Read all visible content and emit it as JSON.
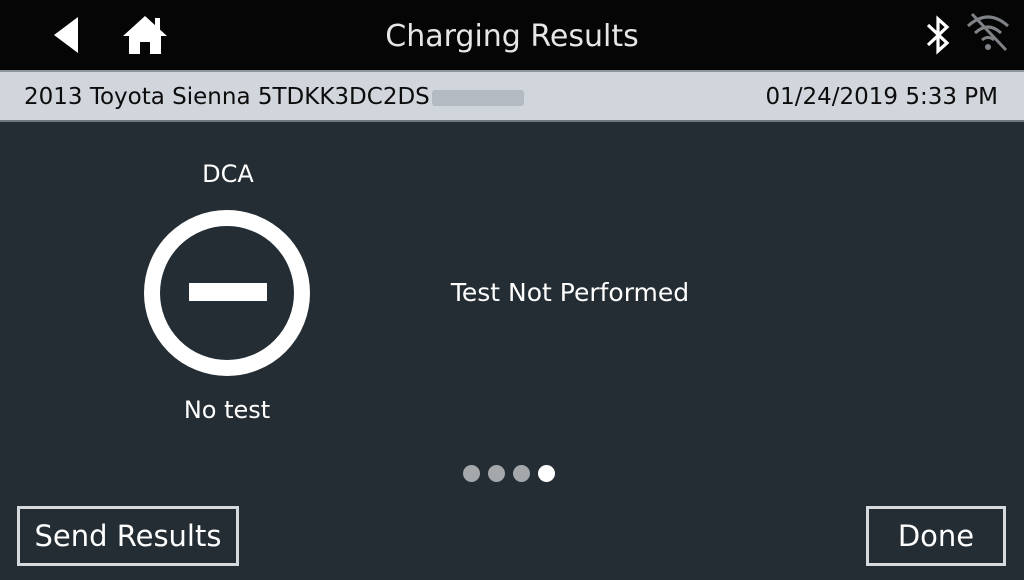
{
  "header": {
    "title": "Charging Results",
    "back_icon": "back-arrow-icon",
    "home_icon": "home-icon",
    "bluetooth_icon": "bluetooth-icon",
    "wifi_icon": "wifi-disconnected-icon"
  },
  "info_bar": {
    "vehicle": "2013 Toyota Sienna  5TDKK3DC2DS",
    "datetime": "01/24/2019 5:33 PM"
  },
  "result": {
    "test_name": "DCA",
    "status": "No test",
    "status_icon": "minus-circle-icon",
    "message": "Test Not Performed"
  },
  "pager": {
    "total": 4,
    "current": 4
  },
  "footer": {
    "send_label": "Send Results",
    "done_label": "Done"
  },
  "colors": {
    "background": "#242d33",
    "topbar": "#050505",
    "infobar": "#d0d6dc",
    "dot_inactive": "#a4a8ab",
    "dot_active": "#ffffff"
  }
}
